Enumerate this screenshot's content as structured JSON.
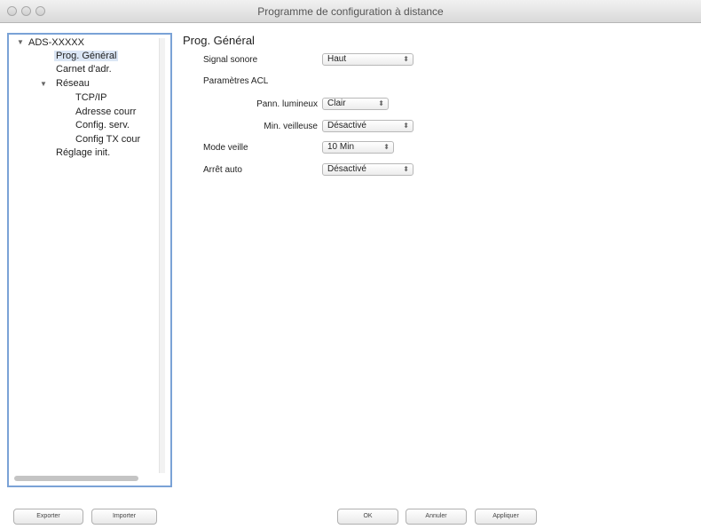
{
  "window": {
    "title": "Programme de configuration à distance"
  },
  "sidebar": {
    "root": "ADS-XXXXX",
    "items": [
      {
        "label": "Prog. Général",
        "selected": true
      },
      {
        "label": "Carnet d'adr."
      },
      {
        "label": "Réseau"
      },
      {
        "label": "TCP/IP"
      },
      {
        "label": "Adresse courr"
      },
      {
        "label": "Config. serv."
      },
      {
        "label": "Config TX cour"
      },
      {
        "label": "Réglage init."
      }
    ]
  },
  "main": {
    "title": "Prog. Général",
    "signal_sonore": {
      "label": "Signal sonore",
      "value": "Haut"
    },
    "acl_header": "Paramètres ACL",
    "pann_lumineux": {
      "label": "Pann. lumineux",
      "value": "Clair"
    },
    "min_veilleuse": {
      "label": "Min. veilleuse",
      "value": "Désactivé"
    },
    "mode_veille": {
      "label": "Mode veille",
      "value": "10 Min"
    },
    "arret_auto": {
      "label": "Arrêt auto",
      "value": "Désactivé"
    }
  },
  "footer": {
    "exporter": "Exporter",
    "importer": "Importer",
    "ok": "OK",
    "annuler": "Annuler",
    "appliquer": "Appliquer"
  }
}
